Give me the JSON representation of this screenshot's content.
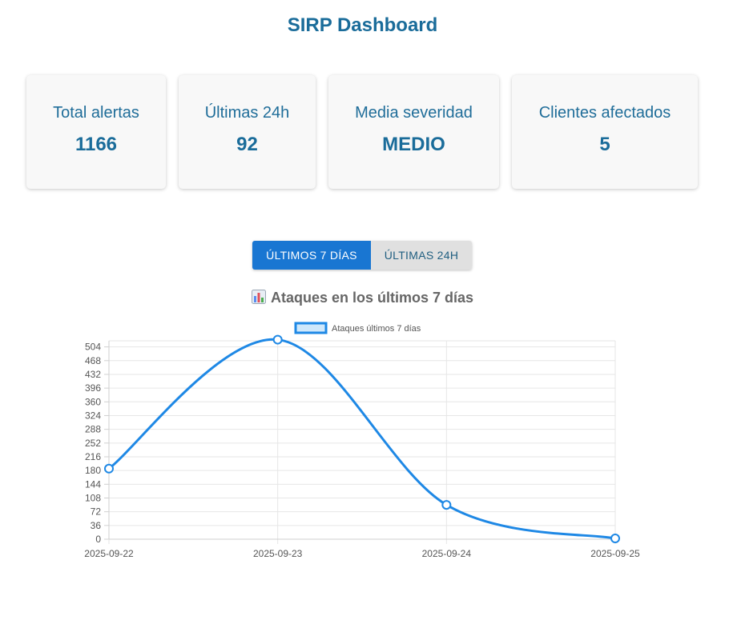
{
  "header": {
    "title": "SIRP Dashboard"
  },
  "stats": [
    {
      "label": "Total alertas",
      "value": "1166"
    },
    {
      "label": "Últimas 24h",
      "value": "92"
    },
    {
      "label": "Media severidad",
      "value": "MEDIO"
    },
    {
      "label": "Clientes afectados",
      "value": "5"
    }
  ],
  "toggle": {
    "option_7d": "ÚLTIMOS 7 DÍAS",
    "option_24h": "ÚLTIMAS 24H",
    "selected": "option_7d"
  },
  "chart_section": {
    "title": "Ataques en los últimos 7 días",
    "icon": "bar-chart-icon"
  },
  "colors": {
    "accent": "#1976d2",
    "line": "#1e88e5",
    "fill": "#cfe8fb",
    "title": "#1a6c9a"
  },
  "chart_data": {
    "type": "line",
    "title": "",
    "x": [
      "2025-09-22",
      "2025-09-23",
      "2025-09-24",
      "2025-09-25"
    ],
    "series": [
      {
        "name": "Ataques últimos 7 días",
        "values": [
          185,
          523,
          90,
          2
        ]
      }
    ],
    "yticks": [
      0,
      36,
      72,
      108,
      144,
      180,
      216,
      252,
      288,
      324,
      360,
      396,
      432,
      468,
      504
    ],
    "ylim": [
      0,
      520
    ],
    "grid": true,
    "legend": "top-center",
    "smooth": true
  }
}
